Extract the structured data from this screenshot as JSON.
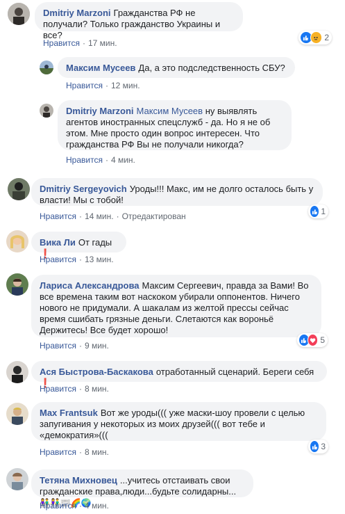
{
  "comments": [
    {
      "author": "Dmitriy Marzoni",
      "text": "Гражданства РФ не получали? Только гражданство Украины и все?",
      "like": "Нравится",
      "time": "17 мин.",
      "reactions_count": "2"
    },
    {
      "author": "Максим Мусеев",
      "text": "Да, а это подследственность СБУ?",
      "like": "Нравится",
      "time": "12 мин."
    },
    {
      "author": "Dmitriy Marzoni",
      "mention": "Максим Мусеев",
      "text": "ну выявлять агентов иностранных спецслужб - да. Но я не об этом. Мне просто один вопрос интересен. Что гражданства РФ Вы не получали никогда?",
      "like": "Нравится",
      "time": "4 мин."
    },
    {
      "author": "Dmitriy Sergeyovich",
      "text": "Уроды!!! Макс, им не долго осталось быть у власти! Мы с тобой!",
      "like": "Нравится",
      "time": "14 мин.",
      "edited": "Отредактирован",
      "reactions_count": "1"
    },
    {
      "author": "Вика Ли",
      "text": "От гады ❗",
      "like": "Нравится",
      "time": "13 мин."
    },
    {
      "author": "Лариса Александрова",
      "text": "Максим Сергеевич, правда за Вами! Во все времена таким вот наскоком убирали оппонентов. Ничего нового не придумали. А шакалам из желтой прессы сейчас время сшибать грязные деньги. Слетаются как вороньё Держитесь! Все будет хорошо!",
      "like": "Нравится",
      "time": "9 мин.",
      "reactions_count": "5"
    },
    {
      "author": "Ася Быстрова-Баскакова",
      "text": "отработанный сценарий. Береги себя ❗",
      "like": "Нравится",
      "time": "8 мин."
    },
    {
      "author": "Max Frantsuk",
      "text": "Вот же уроды((( уже маски-шоу провели с целью запугивания у некоторых из моих друзей((( вот тебе и «демократия»(((",
      "like": "Нравится",
      "time": "8 мин.",
      "reactions_count": "3"
    },
    {
      "author": "Тетяна Михновец",
      "text": "...учитесь отстаивать свои гражданские права,люди...будьте солидарны...",
      "emojis": "👫👫📰🌈🌍",
      "like": "Нравится",
      "time": "4 мин."
    }
  ],
  "colors": {
    "link": "#385898",
    "bubble": "#f2f3f5",
    "meta": "#606770",
    "like_reaction": "#1877f2",
    "love_reaction": "#f33e58",
    "angry_reaction": "#f7b125"
  }
}
